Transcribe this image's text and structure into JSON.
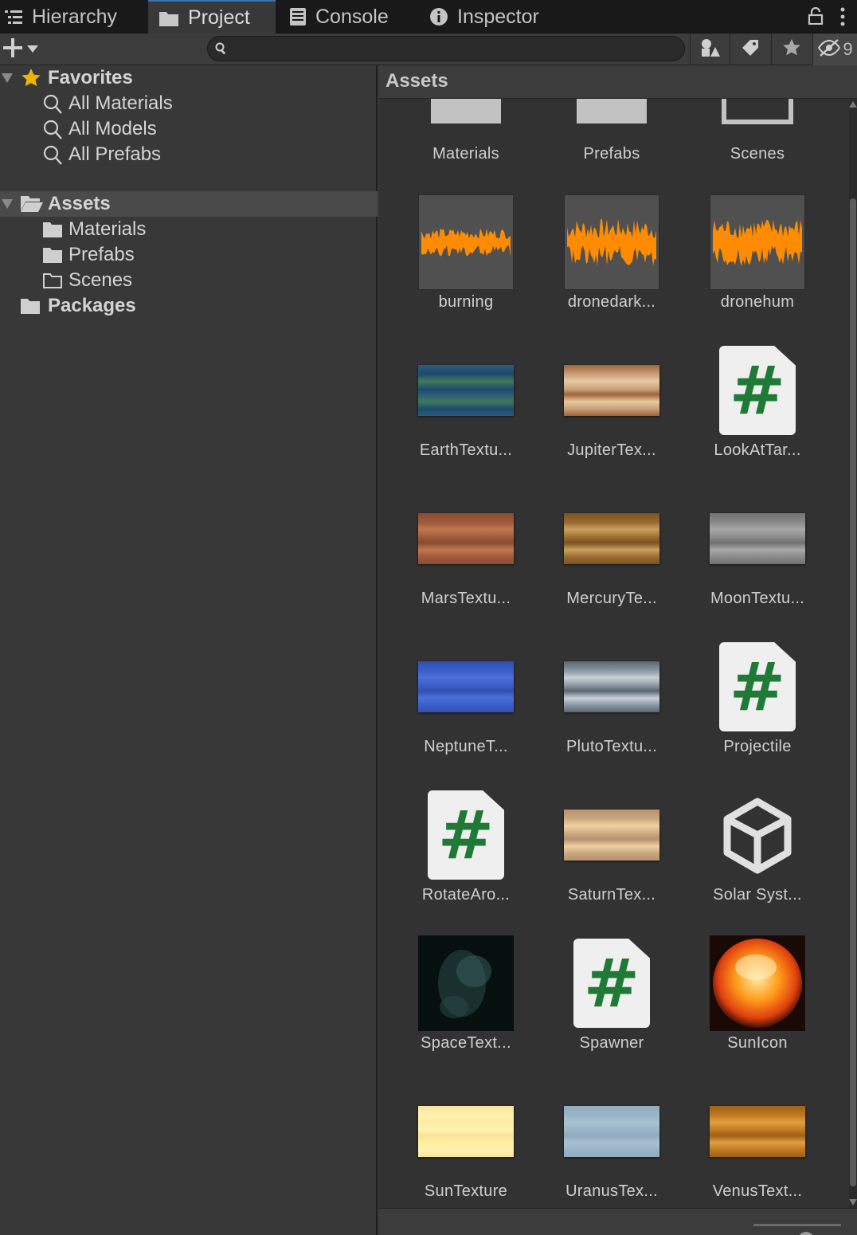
{
  "tabs": [
    {
      "label": "Hierarchy",
      "icon": "list-icon"
    },
    {
      "label": "Project",
      "icon": "folder-icon",
      "active": true
    },
    {
      "label": "Console",
      "icon": "console-icon"
    },
    {
      "label": "Inspector",
      "icon": "info-icon"
    }
  ],
  "toolbar": {
    "search_value": "",
    "hidden_count_partial": "9"
  },
  "tree": {
    "favorites_label": "Favorites",
    "favorites": [
      "All Materials",
      "All Models",
      "All Prefabs"
    ],
    "assets_label": "Assets",
    "assets_children": [
      "Materials",
      "Prefabs",
      "Scenes"
    ],
    "packages_label": "Packages"
  },
  "panel": {
    "title": "Assets",
    "thumbnail_size": 0.6
  },
  "items": [
    {
      "name": "Materials",
      "kind": "folder"
    },
    {
      "name": "Prefabs",
      "kind": "folder"
    },
    {
      "name": "Scenes",
      "kind": "folder-empty"
    },
    {
      "name": "burning",
      "kind": "audio"
    },
    {
      "name": "dronedark...",
      "kind": "audio"
    },
    {
      "name": "dronehum",
      "kind": "audio"
    },
    {
      "name": "EarthTextu...",
      "kind": "texture",
      "colors": [
        "#1d4a6e",
        "#3f7a5a",
        "#2a5c7c"
      ]
    },
    {
      "name": "JupiterTex...",
      "kind": "texture",
      "colors": [
        "#c8a07a",
        "#e8c8a0",
        "#a0623c"
      ]
    },
    {
      "name": "LookAtTar...",
      "kind": "script"
    },
    {
      "name": "MarsTextu...",
      "kind": "texture",
      "colors": [
        "#a05a3a",
        "#c07850",
        "#8a4a30"
      ]
    },
    {
      "name": "MercuryTe...",
      "kind": "texture",
      "colors": [
        "#9a6a30",
        "#c8a060",
        "#7a5220"
      ]
    },
    {
      "name": "MoonTextu...",
      "kind": "texture",
      "colors": [
        "#8a8a8a",
        "#a8a8a8",
        "#707070"
      ]
    },
    {
      "name": "NeptuneT...",
      "kind": "texture",
      "colors": [
        "#3a5ec8",
        "#4c70d8",
        "#3050b0"
      ]
    },
    {
      "name": "PlutoTextu...",
      "kind": "texture",
      "colors": [
        "#8a96a2",
        "#c8d0d8",
        "#5a6670"
      ]
    },
    {
      "name": "Projectile",
      "kind": "script"
    },
    {
      "name": "RotateAro...",
      "kind": "script"
    },
    {
      "name": "SaturnTex...",
      "kind": "texture",
      "colors": [
        "#c8a880",
        "#f0d0a0",
        "#b89070"
      ]
    },
    {
      "name": "Solar Syst...",
      "kind": "unity"
    },
    {
      "name": "SpaceText...",
      "kind": "space"
    },
    {
      "name": "Spawner",
      "kind": "script"
    },
    {
      "name": "SunIcon",
      "kind": "sun"
    },
    {
      "name": "SunTexture",
      "kind": "texture",
      "colors": [
        "#fff2b0",
        "#ffeea0",
        "#f8e49a"
      ]
    },
    {
      "name": "UranusTex...",
      "kind": "texture",
      "colors": [
        "#9ab4c8",
        "#a8c0d0",
        "#90aabe"
      ]
    },
    {
      "name": "VenusText...",
      "kind": "texture",
      "colors": [
        "#c07820",
        "#e0a040",
        "#a06018"
      ]
    }
  ],
  "colors": {
    "accent": "#3a72b0",
    "audio_wave": "#ff8c00",
    "script_hash": "#1f7a35",
    "favorite_star": "#f0b400"
  }
}
